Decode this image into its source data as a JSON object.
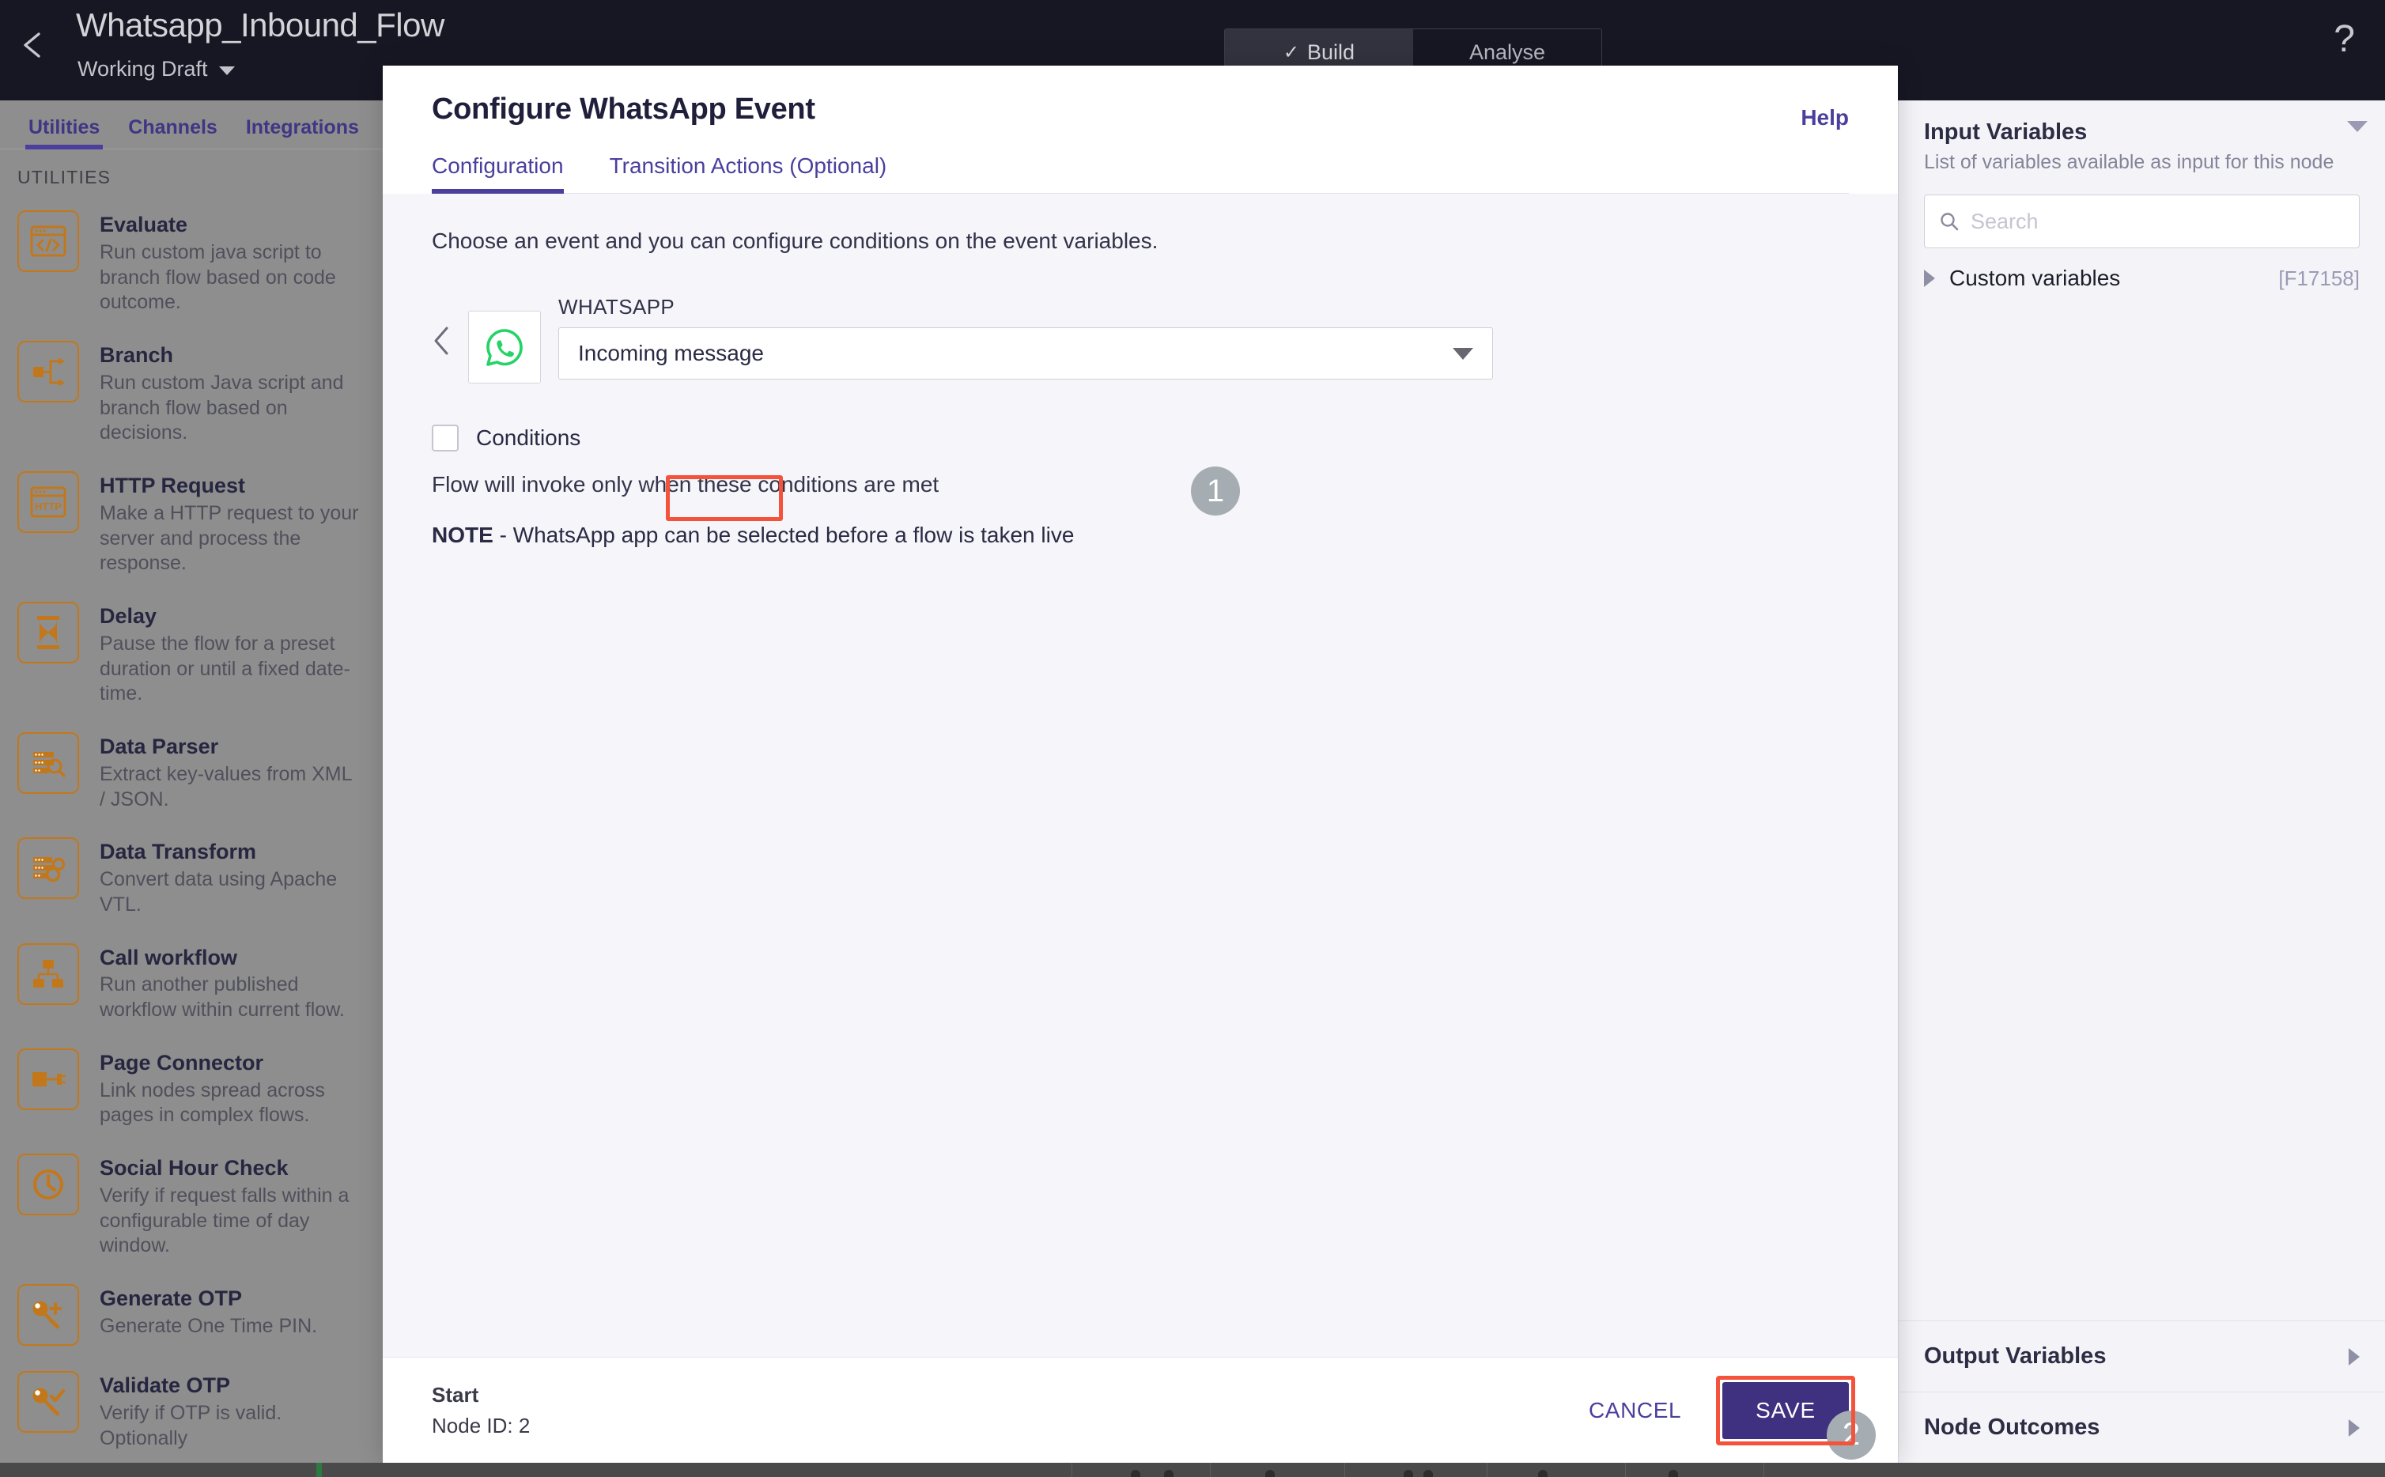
{
  "topbar": {
    "back_icon": "chevron-left-icon",
    "flow_title": "Whatsapp_Inbound_Flow",
    "draft_label": "Working Draft",
    "mode_build": "Build",
    "mode_build_check": "✓",
    "mode_analyse": "Analyse",
    "help_glyph": "?"
  },
  "sidebar": {
    "tabs": [
      {
        "label": "Utilities",
        "active": true
      },
      {
        "label": "Channels",
        "active": false
      },
      {
        "label": "Integrations",
        "active": false
      }
    ],
    "section_label": "UTILITIES",
    "items": [
      {
        "title": "Evaluate",
        "desc": "Run custom java script to branch flow based on code outcome.",
        "icon": "code-window-icon"
      },
      {
        "title": "Branch",
        "desc": "Run custom Java script and branch flow based on decisions.",
        "icon": "branch-icon"
      },
      {
        "title": "HTTP Request",
        "desc": "Make a HTTP request to your server and process the response.",
        "icon": "http-window-icon"
      },
      {
        "title": "Delay",
        "desc": "Pause the flow for a preset duration or until a fixed date-time.",
        "icon": "hourglass-icon"
      },
      {
        "title": "Data Parser",
        "desc": "Extract key-values from XML / JSON.",
        "icon": "database-search-icon"
      },
      {
        "title": "Data Transform",
        "desc": "Convert data using Apache VTL.",
        "icon": "database-gear-icon"
      },
      {
        "title": "Call workflow",
        "desc": "Run another published workflow within current flow.",
        "icon": "sitemap-icon"
      },
      {
        "title": "Page Connector",
        "desc": "Link nodes spread across pages in complex flows.",
        "icon": "connector-icon"
      },
      {
        "title": "Social Hour Check",
        "desc": "Verify if request falls within a configurable time of day window.",
        "icon": "clock-icon"
      },
      {
        "title": "Generate OTP",
        "desc": "Generate One Time PIN.",
        "icon": "key-plus-icon"
      },
      {
        "title": "Validate OTP",
        "desc": "Verify if OTP is valid. Optionally",
        "icon": "key-check-icon"
      }
    ]
  },
  "modal": {
    "title": "Configure WhatsApp Event",
    "help_label": "Help",
    "tabs": [
      {
        "label": "Configuration",
        "active": true
      },
      {
        "label": "Transition Actions (Optional)",
        "active": false
      }
    ],
    "intro": "Choose an event and you can configure conditions on the event variables.",
    "event": {
      "back_icon": "chevron-left-icon",
      "app_icon": "whatsapp-icon",
      "caption": "WHATSAPP",
      "selected_value": "Incoming message",
      "caret_icon": "chevron-down-icon"
    },
    "conditions_label": "Conditions",
    "conditions_help": "Flow will invoke only when these conditions are met",
    "note_prefix": "NOTE",
    "note_text": "- WhatsApp app can be selected before a flow is taken live",
    "footer": {
      "node_name": "Start",
      "node_id": "Node ID: 2",
      "cancel_label": "CANCEL",
      "save_label": "SAVE"
    }
  },
  "annotations": {
    "badge_one": "1",
    "badge_two": "2",
    "highlight_color": "#f4523b",
    "badge_color": "#a6adb2"
  },
  "right_panel": {
    "title": "Input Variables",
    "subtitle": "List of variables available as input for this node",
    "collapse_icon": "caret-down-icon",
    "search_placeholder": "Search",
    "search_value": "",
    "search_icon": "search-icon",
    "rows": [
      {
        "label": "Custom variables",
        "tag": "[F17158]"
      }
    ],
    "sections": [
      {
        "label": "Output Variables"
      },
      {
        "label": "Node Outcomes"
      }
    ]
  },
  "colors": {
    "accent_purple": "#4b3f9e",
    "save_purple": "#3f3080",
    "icon_orange": "#c2781a",
    "whatsapp_green": "#25d366",
    "topbar_dark": "#171724",
    "sidebar_gray": "#8e8e8e"
  }
}
